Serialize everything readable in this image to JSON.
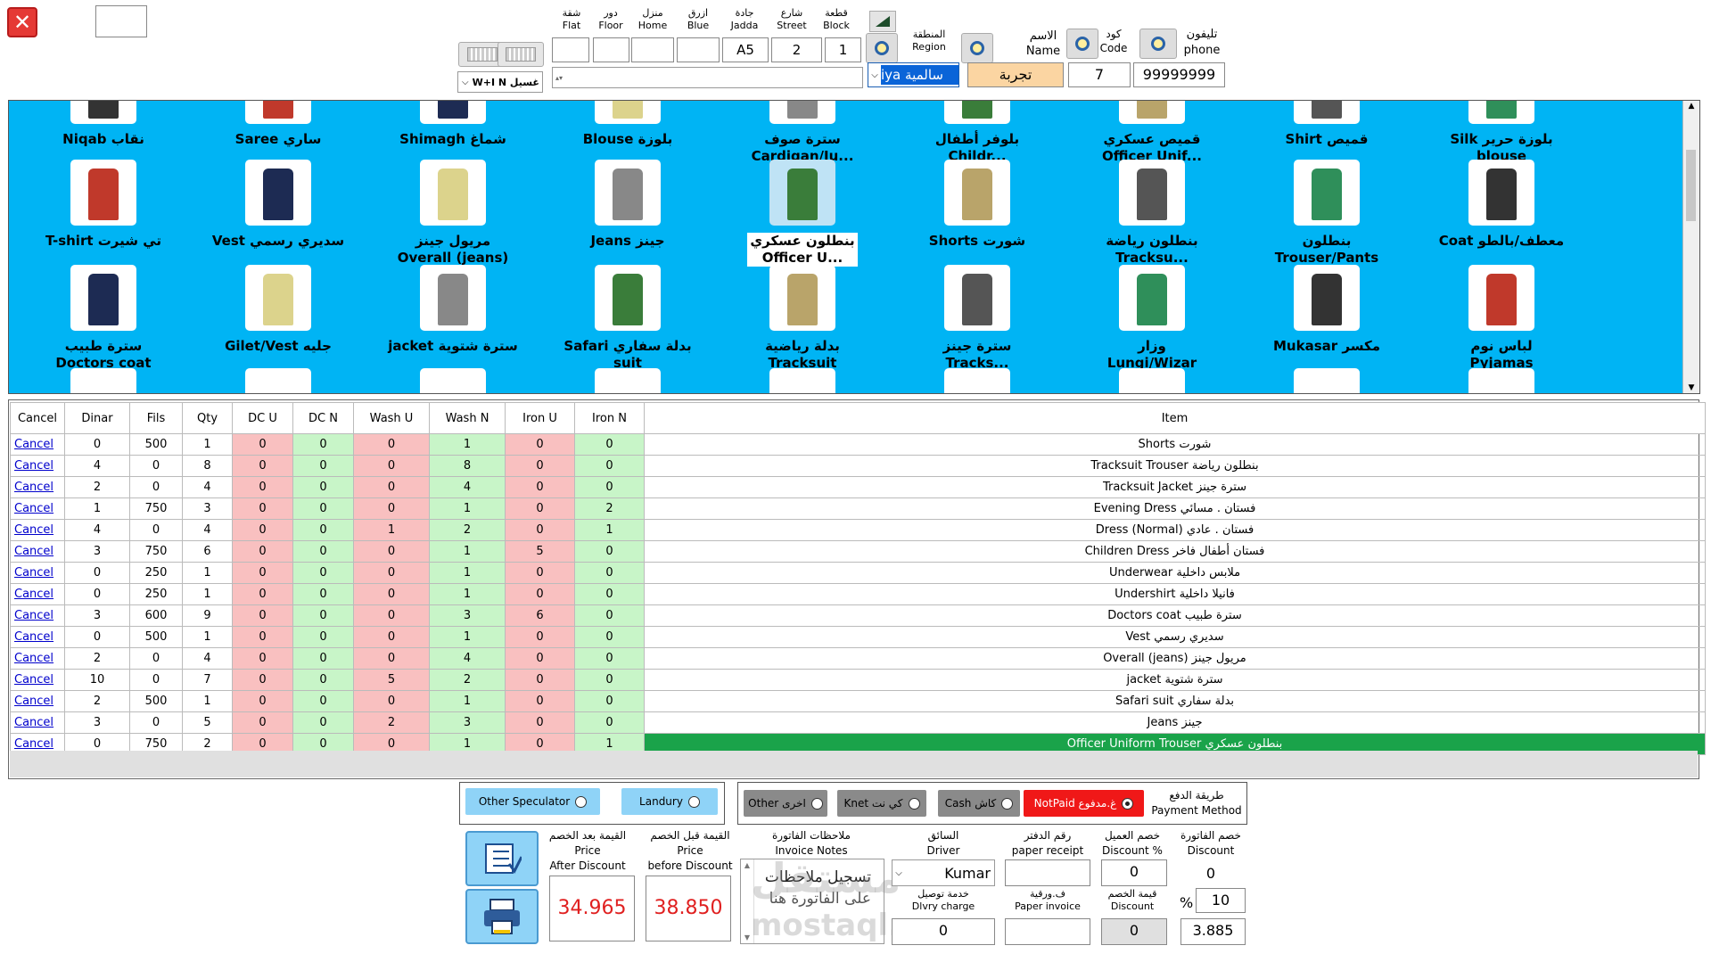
{
  "top": {
    "close_icon": "close-icon",
    "service_combo": "W+I N غسيل",
    "address_labels": [
      {
        "ar": "شقة",
        "en": "Flat"
      },
      {
        "ar": "دور",
        "en": "Floor"
      },
      {
        "ar": "منزل",
        "en": "Home"
      },
      {
        "ar": "ازرق",
        "en": "Blue"
      },
      {
        "ar": "جادة",
        "en": "Jadda"
      },
      {
        "ar": "شارع",
        "en": "Street"
      },
      {
        "ar": "قطعة",
        "en": "Block"
      }
    ],
    "address_values": [
      "",
      "",
      "",
      "",
      "A5",
      "2",
      "1"
    ],
    "region_label_ar": "المنطقة",
    "region_label_en": "Region",
    "region_value": "سالمية",
    "region_prefix": "iya",
    "name_label_ar": "الاسم",
    "name_label_en": "Name",
    "name_value": "تجربة",
    "code_label_ar": "كود",
    "code_label_en": "Code",
    "code_value": "7",
    "phone_label_ar": "تليفون",
    "phone_label_en": "phone",
    "phone_value": "99999999"
  },
  "catalog": {
    "row0": [
      {
        "l1": "Niqab نقاب",
        "l2": ""
      },
      {
        "l1": "Saree ساري",
        "l2": ""
      },
      {
        "l1": "Shimagh شماغ",
        "l2": ""
      },
      {
        "l1": "Blouse بلوزة",
        "l2": ""
      },
      {
        "l1": "سترة صوف",
        "l2": "Cardigan/Ju..."
      },
      {
        "l1": "بلوفر أطفال",
        "l2": "Childr..."
      },
      {
        "l1": "قميص عسكري",
        "l2": "Officer Unif..."
      },
      {
        "l1": "Shirt قميص",
        "l2": ""
      },
      {
        "l1": "Silk بلوزة حرير",
        "l2": "blouse"
      }
    ],
    "row1": [
      {
        "l1": "T-shirt تي شيرت",
        "l2": ""
      },
      {
        "l1": "Vest سديري رسمي",
        "l2": ""
      },
      {
        "l1": "مريول جينز",
        "l2": "Overall (jeans)"
      },
      {
        "l1": "Jeans جينز",
        "l2": ""
      },
      {
        "l1": "بنطلون عسكري",
        "l2": "Officer U..."
      },
      {
        "l1": "Shorts شورت",
        "l2": ""
      },
      {
        "l1": "بنطلون رياضة",
        "l2": "Tracksu..."
      },
      {
        "l1": "بنطلون",
        "l2": "Trouser/Pants"
      },
      {
        "l1": "Coat معطف/بالطو",
        "l2": ""
      }
    ],
    "row2": [
      {
        "l1": "سترة طبيب",
        "l2": "Doctors coat"
      },
      {
        "l1": "Gilet/Vest جليه",
        "l2": ""
      },
      {
        "l1": "jacket سترة شتوية",
        "l2": ""
      },
      {
        "l1": "Safari بدلة سفاري",
        "l2": "suit"
      },
      {
        "l1": "بدلة رياضية",
        "l2": "Tracksuit"
      },
      {
        "l1": "سترة جينز",
        "l2": "Tracks..."
      },
      {
        "l1": "وزار",
        "l2": "Lungi/Wizar"
      },
      {
        "l1": "Mukasar مكسر",
        "l2": ""
      },
      {
        "l1": "لباس نوم",
        "l2": "Pyjamas"
      }
    ]
  },
  "grid": {
    "headers": [
      "Cancel",
      "Dinar",
      "Fils",
      "Qty",
      "DC U",
      "DC N",
      "Wash U",
      "Wash N",
      "Iron U",
      "Iron N",
      "Item"
    ],
    "cancel_label": "Cancel",
    "rows": [
      [
        "0",
        "500",
        "1",
        "0",
        "0",
        "0",
        "1",
        "0",
        "0",
        "Shorts شورت"
      ],
      [
        "4",
        "0",
        "8",
        "0",
        "0",
        "0",
        "8",
        "0",
        "0",
        "Tracksuit Trouser بنطلون رياضة"
      ],
      [
        "2",
        "0",
        "4",
        "0",
        "0",
        "0",
        "4",
        "0",
        "0",
        "Tracksuit Jacket سترة جينز"
      ],
      [
        "1",
        "750",
        "3",
        "0",
        "0",
        "0",
        "1",
        "0",
        "2",
        "Evening Dress فستان . مسائي"
      ],
      [
        "4",
        "0",
        "4",
        "0",
        "0",
        "1",
        "2",
        "0",
        "1",
        "Dress (Normal) فستان . عادي"
      ],
      [
        "3",
        "750",
        "6",
        "0",
        "0",
        "0",
        "1",
        "5",
        "0",
        "Children Dress فستان أطفال فاخر"
      ],
      [
        "0",
        "250",
        "1",
        "0",
        "0",
        "0",
        "1",
        "0",
        "0",
        "Underwear ملابس داخلية"
      ],
      [
        "0",
        "250",
        "1",
        "0",
        "0",
        "0",
        "1",
        "0",
        "0",
        "Undershirt فانيلا داخلية"
      ],
      [
        "3",
        "600",
        "9",
        "0",
        "0",
        "0",
        "3",
        "6",
        "0",
        "Doctors coat سترة طبيب"
      ],
      [
        "0",
        "500",
        "1",
        "0",
        "0",
        "0",
        "1",
        "0",
        "0",
        "Vest سديري رسمي"
      ],
      [
        "2",
        "0",
        "4",
        "0",
        "0",
        "0",
        "4",
        "0",
        "0",
        "Overall (jeans) مريول جينز"
      ],
      [
        "10",
        "0",
        "7",
        "0",
        "0",
        "5",
        "2",
        "0",
        "0",
        "jacket سترة شتوية"
      ],
      [
        "2",
        "500",
        "1",
        "0",
        "0",
        "0",
        "1",
        "0",
        "0",
        "Safari suit بدلة سفاري"
      ],
      [
        "3",
        "0",
        "5",
        "0",
        "0",
        "2",
        "3",
        "0",
        "0",
        "Jeans جينز"
      ],
      [
        "0",
        "750",
        "2",
        "0",
        "0",
        "0",
        "1",
        "0",
        "1",
        "Officer Uniform Trouser بنطلون عسكري"
      ]
    ]
  },
  "bottom": {
    "other_speculator": "Other Speculator",
    "laundry": "Landury",
    "pay_other": "Other اخرى",
    "pay_knet": "Knet كي نت",
    "pay_cash": "Cash كاش",
    "pay_notpaid": "NotPaid غ.مدفوع",
    "payment_method_ar": "طريقة الدفع",
    "payment_method_en": "Payment Method",
    "after_discount_ar": "القيمة بعد الخصم",
    "after_discount_en1": "Price",
    "after_discount_en2": "After Discount",
    "before_discount_ar": "القيمة قبل الخصم",
    "before_discount_en1": "Price",
    "before_discount_en2": "before Discount",
    "invoice_notes_ar": "ملاحظات الفاتورة",
    "invoice_notes_en": "Invoice Notes",
    "notes_text1": "تسجيل ملاحظات",
    "notes_text2": "على الفاتورة هنا",
    "driver_ar": "السائق",
    "driver_en": "Driver",
    "driver_value": "Kumar",
    "delivery_ar": "خدمة توصيل",
    "delivery_en": "Dlvry charge",
    "delivery_value": "0",
    "paper_receipt_ar": "رقم الدفتر",
    "paper_receipt_en": "paper receipt",
    "paper_invoice_ar": "ف.ورقية",
    "paper_invoice_en": "Paper invoice",
    "cust_discount_ar": "خصم العميل",
    "cust_discount_en": "Discount %",
    "cust_discount_value": "0",
    "discount_value_ar": "قيمة الخصم",
    "discount_value_en": "Discount",
    "discount_value": "0",
    "invoice_discount_ar": "خصم الفاتورة",
    "invoice_discount_en": "Discount",
    "invoice_discount_value": "0",
    "percent_sign": "%",
    "percent_value": "10",
    "discount_amount": "3.885",
    "price_after": "34.965",
    "price_before": "38.850",
    "watermark1": "مستقل",
    "watermark2": "mostaql.com"
  }
}
